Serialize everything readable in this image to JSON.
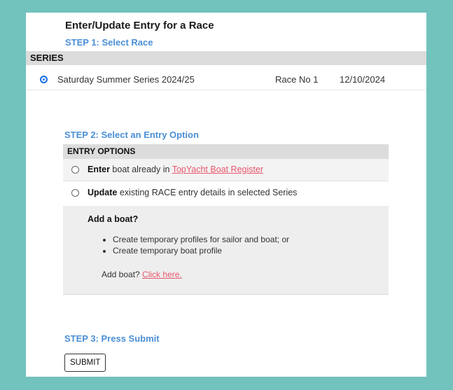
{
  "page": {
    "title": "Enter/Update Entry for a Race",
    "step1": "STEP 1: Select Race",
    "step2": "STEP 2: Select an Entry Option",
    "step3": "STEP 3: Press Submit"
  },
  "series": {
    "header": "SERIES",
    "rows": [
      {
        "name": "Saturday Summer Series 2024/25",
        "race": "Race No 1",
        "date": "12/10/2024",
        "selected": true
      }
    ]
  },
  "entry_options": {
    "header": "ENTRY OPTIONS",
    "enter": {
      "bold": "Enter",
      "text": " boat already in ",
      "link": "TopYacht Boat Register"
    },
    "update": {
      "bold": "Update",
      "text": " existing RACE entry details in selected Series"
    }
  },
  "add_boat": {
    "title": "Add a boat?",
    "bullets": [
      "Create temporary profiles for sailor and boat; or",
      "Create temporary boat profile"
    ],
    "prompt": "Add boat? ",
    "link": "Click here."
  },
  "submit_label": "SUBMIT",
  "colors": {
    "background": "#72c2bd",
    "step_heading": "#4a8fd6",
    "link": "#e8566c",
    "radio_selected": "#1a73e8"
  }
}
